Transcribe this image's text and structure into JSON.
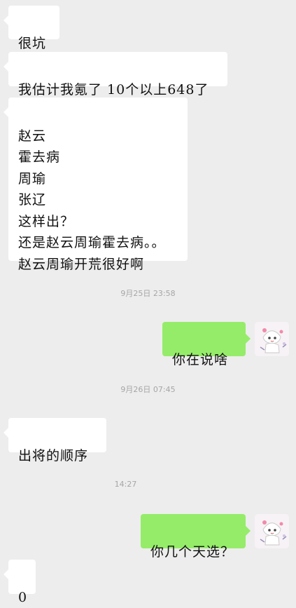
{
  "messages": [
    {
      "text": "很坑"
    },
    {
      "text": "我估计我氪了 10个以上648了"
    },
    {
      "text": "赵云\n霍去病\n周瑜\n张辽\n这样出？\n还是赵云周瑜霍去病。。\n赵云周瑜开荒很好啊"
    },
    {
      "text": "你在说啥"
    },
    {
      "text": "出将的顺序"
    },
    {
      "text": "你几个天选？"
    },
    {
      "text": "0"
    }
  ],
  "timestamps": [
    "9月25日 23:58",
    "9月26日 07:45",
    "14:27"
  ],
  "colors": {
    "background": "#ededed",
    "incoming": "#ffffff",
    "outgoing": "#95ec69"
  },
  "avatar_icon": "anime-avatar-icon"
}
